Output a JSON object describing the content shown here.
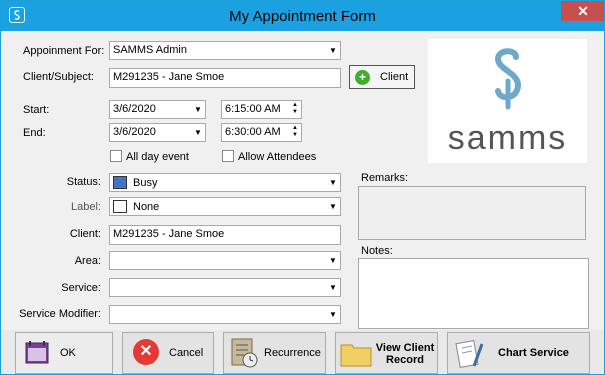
{
  "window": {
    "title": "My Appointment Form",
    "close_label": "✕"
  },
  "form": {
    "appointment_for_label": "Appoinment For:",
    "appointment_for_value": "SAMMS Admin",
    "client_subject_label": "Client/Subject:",
    "client_subject_value": "M291235 - Jane Smoe",
    "client_button_label": "Client",
    "start_label": "Start:",
    "start_date": "3/6/2020",
    "start_time": "6:15:00 AM",
    "end_label": "End:",
    "end_date": "3/6/2020",
    "end_time": "6:30:00 AM",
    "all_day_label": "All day event",
    "allow_attendees_label": "Allow Attendees",
    "status_label": "Status:",
    "status_value": "Busy",
    "status_color": "#4472c4",
    "label_label": "Label:",
    "label_value": "None",
    "client_label": "Client:",
    "client_value": "M291235 - Jane Smoe",
    "area_label": "Area:",
    "area_value": "",
    "service_label": "Service:",
    "service_value": "",
    "service_modifier_label": "Service Modifier:",
    "service_modifier_value": "",
    "remarks_label": "Remarks:",
    "notes_label": "Notes:"
  },
  "logo": {
    "text": "samms",
    "accent": "#6fa9c9"
  },
  "buttons": {
    "ok": "OK",
    "cancel": "Cancel",
    "recurrence": "Recurrence",
    "view_client_record_line1": "View Client",
    "view_client_record_line2": "Record",
    "chart_service": "Chart Service"
  }
}
